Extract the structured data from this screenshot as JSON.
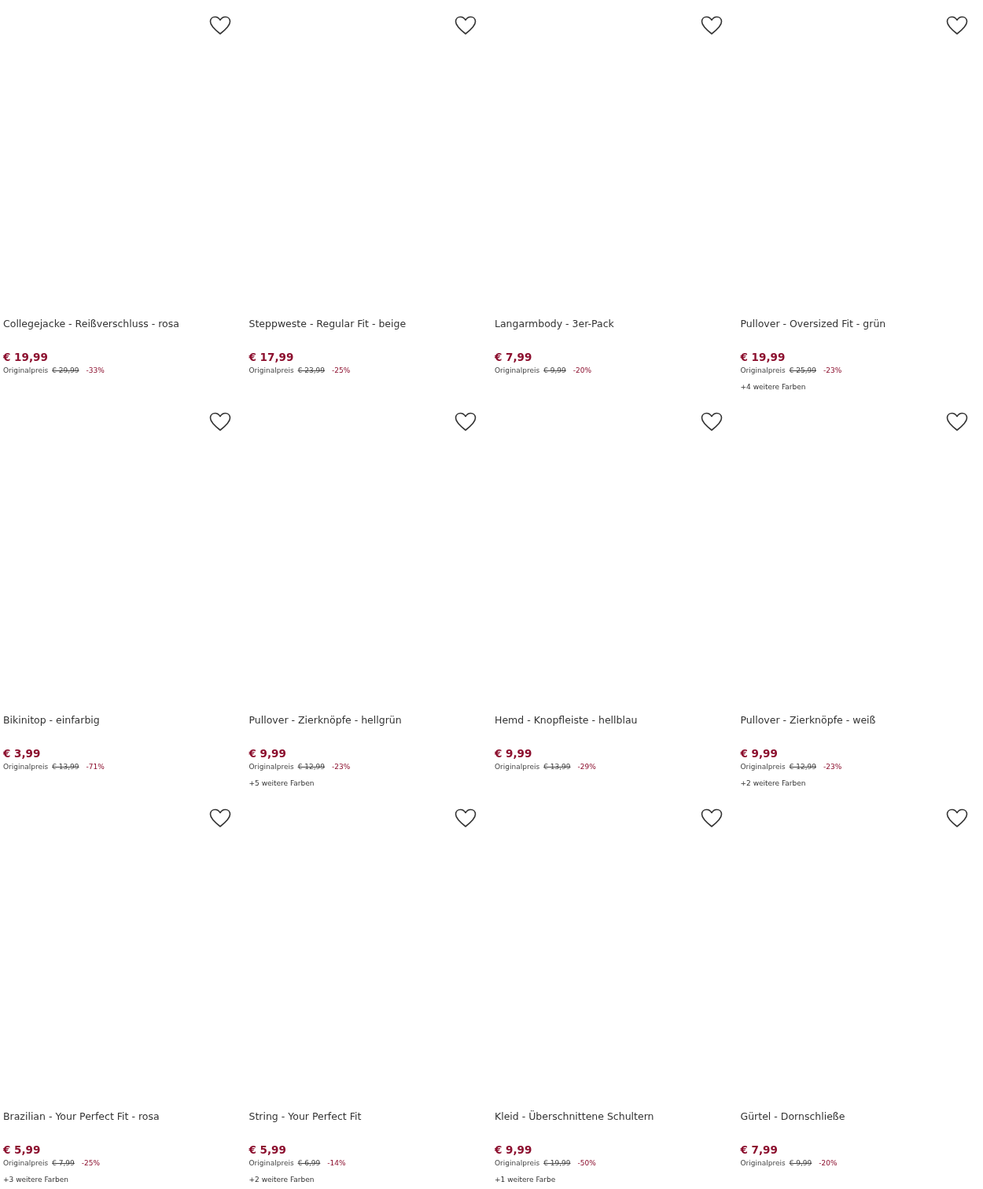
{
  "products": [
    {
      "title": "Collegejacke - Reißverschluss - rosa",
      "price": "€ 19,99",
      "original_label": "Originalpreis",
      "original_price": "€ 29,99",
      "discount": "-33%"
    },
    {
      "title": "Steppweste - Regular Fit - beige",
      "price": "€ 17,99",
      "original_label": "Originalpreis",
      "original_price": "€ 23,99",
      "discount": "-25%"
    },
    {
      "title": "Langarmbody - 3er-Pack",
      "price": "€ 7,99",
      "original_label": "Originalpreis",
      "original_price": "€ 9,99",
      "discount": "-20%"
    },
    {
      "title": "Pullover - Oversized Fit - grün",
      "price": "€ 19,99",
      "original_label": "Originalpreis",
      "original_price": "€ 25,99",
      "discount": "-23%",
      "more_colors": "+4 weitere Farben"
    },
    {
      "title": "Bikinitop - einfarbig",
      "price": "€ 3,99",
      "original_label": "Originalpreis",
      "original_price": "€ 13,99",
      "discount": "-71%"
    },
    {
      "title": "Pullover - Zierknöpfe - hellgrün",
      "price": "€ 9,99",
      "original_label": "Originalpreis",
      "original_price": "€ 12,99",
      "discount": "-23%",
      "more_colors": "+5 weitere Farben"
    },
    {
      "title": "Hemd - Knopfleiste - hellblau",
      "price": "€ 9,99",
      "original_label": "Originalpreis",
      "original_price": "€ 13,99",
      "discount": "-29%"
    },
    {
      "title": "Pullover - Zierknöpfe - weiß",
      "price": "€ 9,99",
      "original_label": "Originalpreis",
      "original_price": "€ 12,99",
      "discount": "-23%",
      "more_colors": "+2 weitere Farben"
    },
    {
      "title": "Brazilian - Your Perfect Fit - rosa",
      "price": "€ 5,99",
      "original_label": "Originalpreis",
      "original_price": "€ 7,99",
      "discount": "-25%",
      "more_colors": "+3 weitere Farben"
    },
    {
      "title": "String - Your Perfect Fit",
      "price": "€ 5,99",
      "original_label": "Originalpreis",
      "original_price": "€ 6,99",
      "discount": "-14%",
      "more_colors": "+2 weitere Farben"
    },
    {
      "title": "Kleid - Überschnittene Schultern",
      "price": "€ 9,99",
      "original_label": "Originalpreis",
      "original_price": "€ 19,99",
      "discount": "-50%",
      "more_colors": "+1 weitere Farbe"
    },
    {
      "title": "Gürtel - Dornschließe",
      "price": "€ 7,99",
      "original_label": "Originalpreis",
      "original_price": "€ 9,99",
      "discount": "-20%"
    }
  ]
}
